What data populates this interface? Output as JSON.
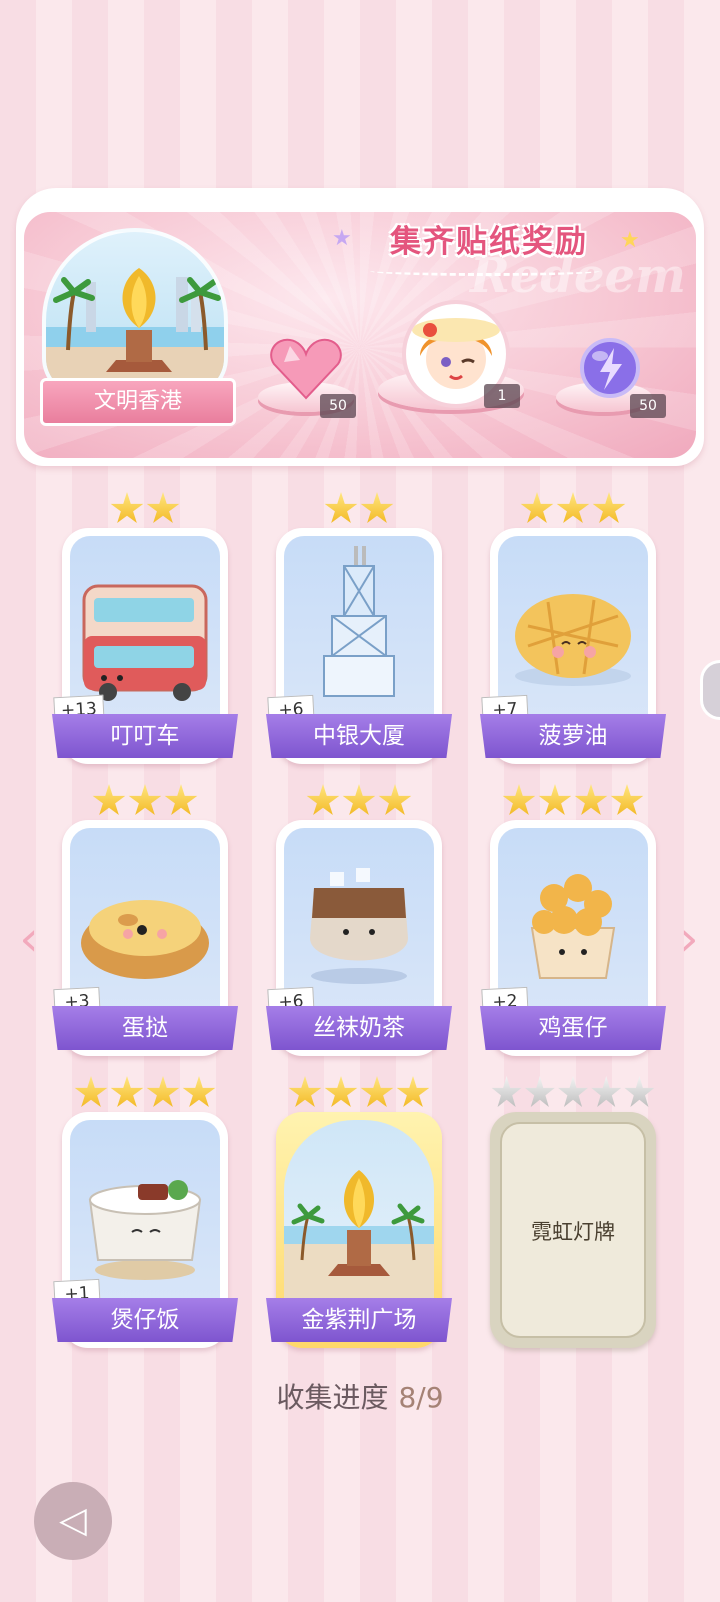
{
  "banner": {
    "title": "集齐贴纸奖励",
    "deco_text": "Redeem",
    "city_name": "文明香港",
    "rewards": [
      {
        "item": "pink-heart-gem-icon",
        "count": "50"
      },
      {
        "item": "character-avatar-icon",
        "count": "1"
      },
      {
        "item": "purple-lightning-orb-icon",
        "count": "50"
      }
    ]
  },
  "cards": [
    {
      "name": "叮叮车",
      "count": "+13",
      "stars": 2,
      "art": "double-decker-tram-icon"
    },
    {
      "name": "中银大厦",
      "count": "+6",
      "stars": 2,
      "art": "bank-tower-icon"
    },
    {
      "name": "菠萝油",
      "count": "+7",
      "stars": 3,
      "art": "pineapple-bun-icon"
    },
    {
      "name": "蛋挞",
      "count": "+3",
      "stars": 3,
      "art": "egg-tart-icon"
    },
    {
      "name": "丝袜奶茶",
      "count": "+6",
      "stars": 3,
      "art": "milk-tea-icon"
    },
    {
      "name": "鸡蛋仔",
      "count": "+2",
      "stars": 4,
      "art": "egg-waffle-icon"
    },
    {
      "name": "煲仔饭",
      "count": "+1",
      "stars": 4,
      "art": "claypot-rice-icon"
    },
    {
      "name": "金紫荆广场",
      "count": "",
      "stars": 4,
      "art": "golden-bauhinia-icon"
    },
    {
      "name": "霓虹灯牌",
      "count": "",
      "stars": 5,
      "art": "locked"
    }
  ],
  "progress": {
    "label": "收集进度",
    "value": "8/9"
  }
}
